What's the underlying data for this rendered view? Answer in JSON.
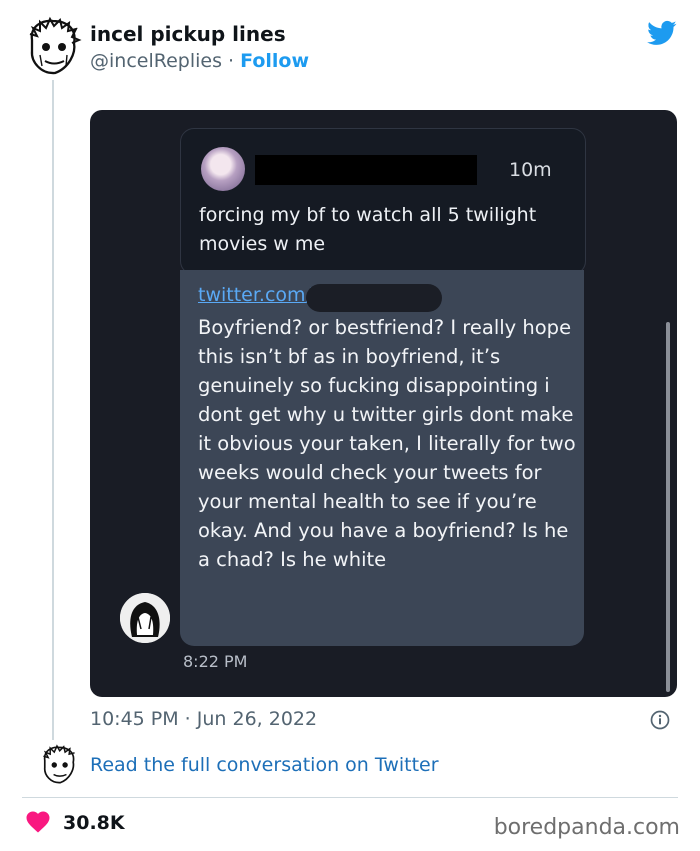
{
  "header": {
    "display_name": "incel pickup lines",
    "handle": "@incelReplies",
    "separator": "·",
    "follow_label": "Follow"
  },
  "screenshot": {
    "quoted_tweet": {
      "time_ago": "10m",
      "text": "forcing my bf to watch all 5 twilight movies w me"
    },
    "message": {
      "link_text": "twitter.com/",
      "body": "Boyfriend? or bestfriend? I really hope this isn’t bf as in boyfriend, it’s genuinely so fucking disappointing i dont get why u twitter girls dont make it obvious your taken, I literally for two weeks would check your tweets for your mental health to see if you’re okay. And you have a boyfriend? Is he a chad? Is he white",
      "sent_time": "8:22 PM"
    }
  },
  "footer": {
    "timestamp": "10:45 PM · Jun 26, 2022",
    "read_conversation": "Read the full conversation on Twitter",
    "likes": "30.8K",
    "watermark": "boredpanda.com"
  },
  "colors": {
    "twitter_blue": "#1d9bf0",
    "like_red": "#f91880",
    "dark_bg": "#191c25",
    "bubble": "#3c4656"
  },
  "icons": [
    "incel-avatar-icon",
    "twitter-bird-icon",
    "info-icon",
    "heart-icon"
  ]
}
